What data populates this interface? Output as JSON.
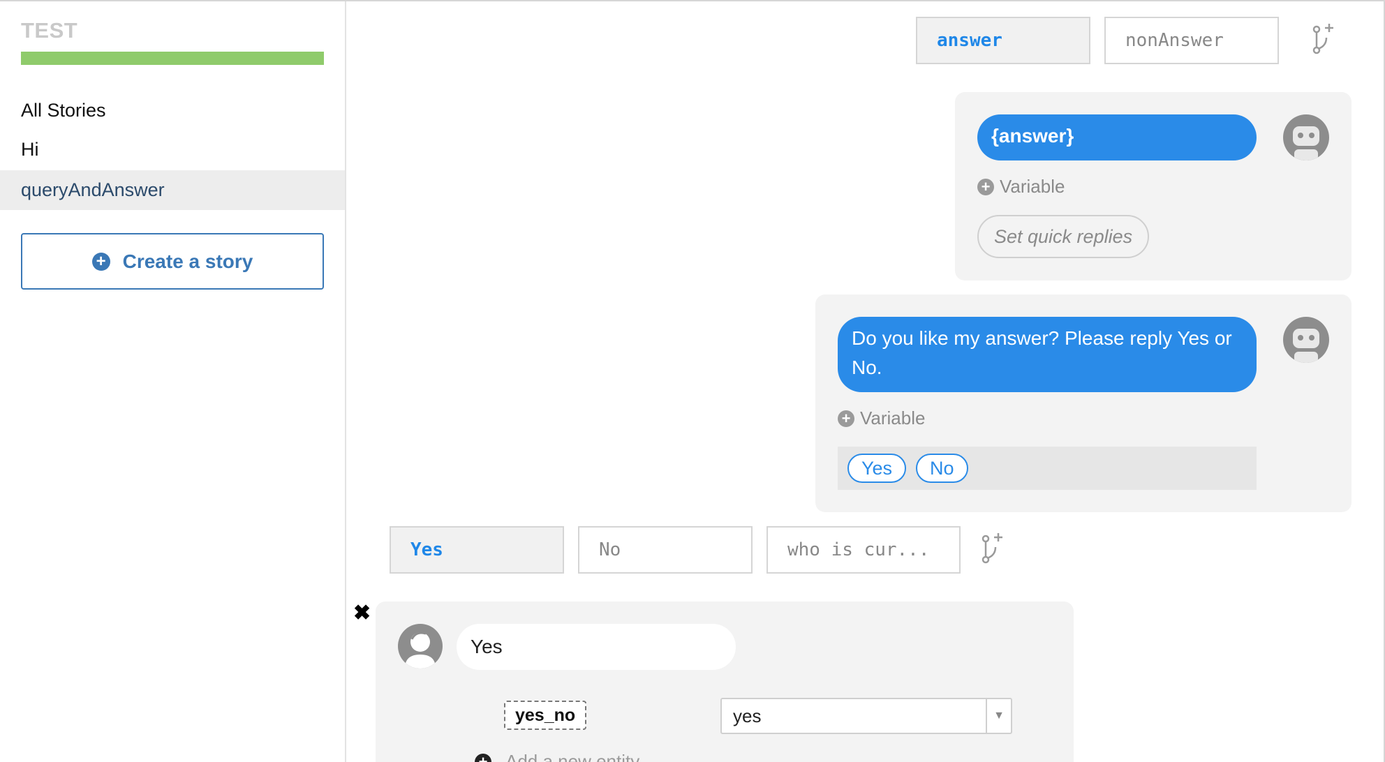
{
  "app": {
    "brand": "TEST",
    "progress": 1.0
  },
  "colors": {
    "accent": "#2a8be8",
    "progress": "#8fcb6b",
    "create_button": "#3a78b6"
  },
  "sidebar": {
    "items": [
      {
        "label": "All Stories"
      },
      {
        "label": "Hi"
      },
      {
        "label": "queryAndAnswer",
        "active": true
      }
    ],
    "create_label": "Create a story",
    "create_icon": "plus-circle-icon"
  },
  "top_branches": {
    "tabs": [
      {
        "label": "answer",
        "active": true
      },
      {
        "label": "nonAnswer"
      }
    ],
    "add_icon": "branch-add-icon"
  },
  "bot_messages": [
    {
      "text": "{answer}",
      "variable_label": "Variable",
      "quick_reply_placeholder": "Set quick replies"
    },
    {
      "text": "Do you like my answer? Please reply Yes or No.",
      "variable_label": "Variable",
      "quick_replies": [
        "Yes",
        "No"
      ]
    }
  ],
  "reply_branches": {
    "tabs": [
      {
        "label": "Yes",
        "active": true
      },
      {
        "label": "No"
      },
      {
        "label": "who is cur..."
      }
    ],
    "add_icon": "branch-add-icon"
  },
  "user_message": {
    "text": "Yes",
    "entity": {
      "name": "yes_no",
      "value": "yes"
    },
    "add_entity_label": "Add a new entity"
  }
}
